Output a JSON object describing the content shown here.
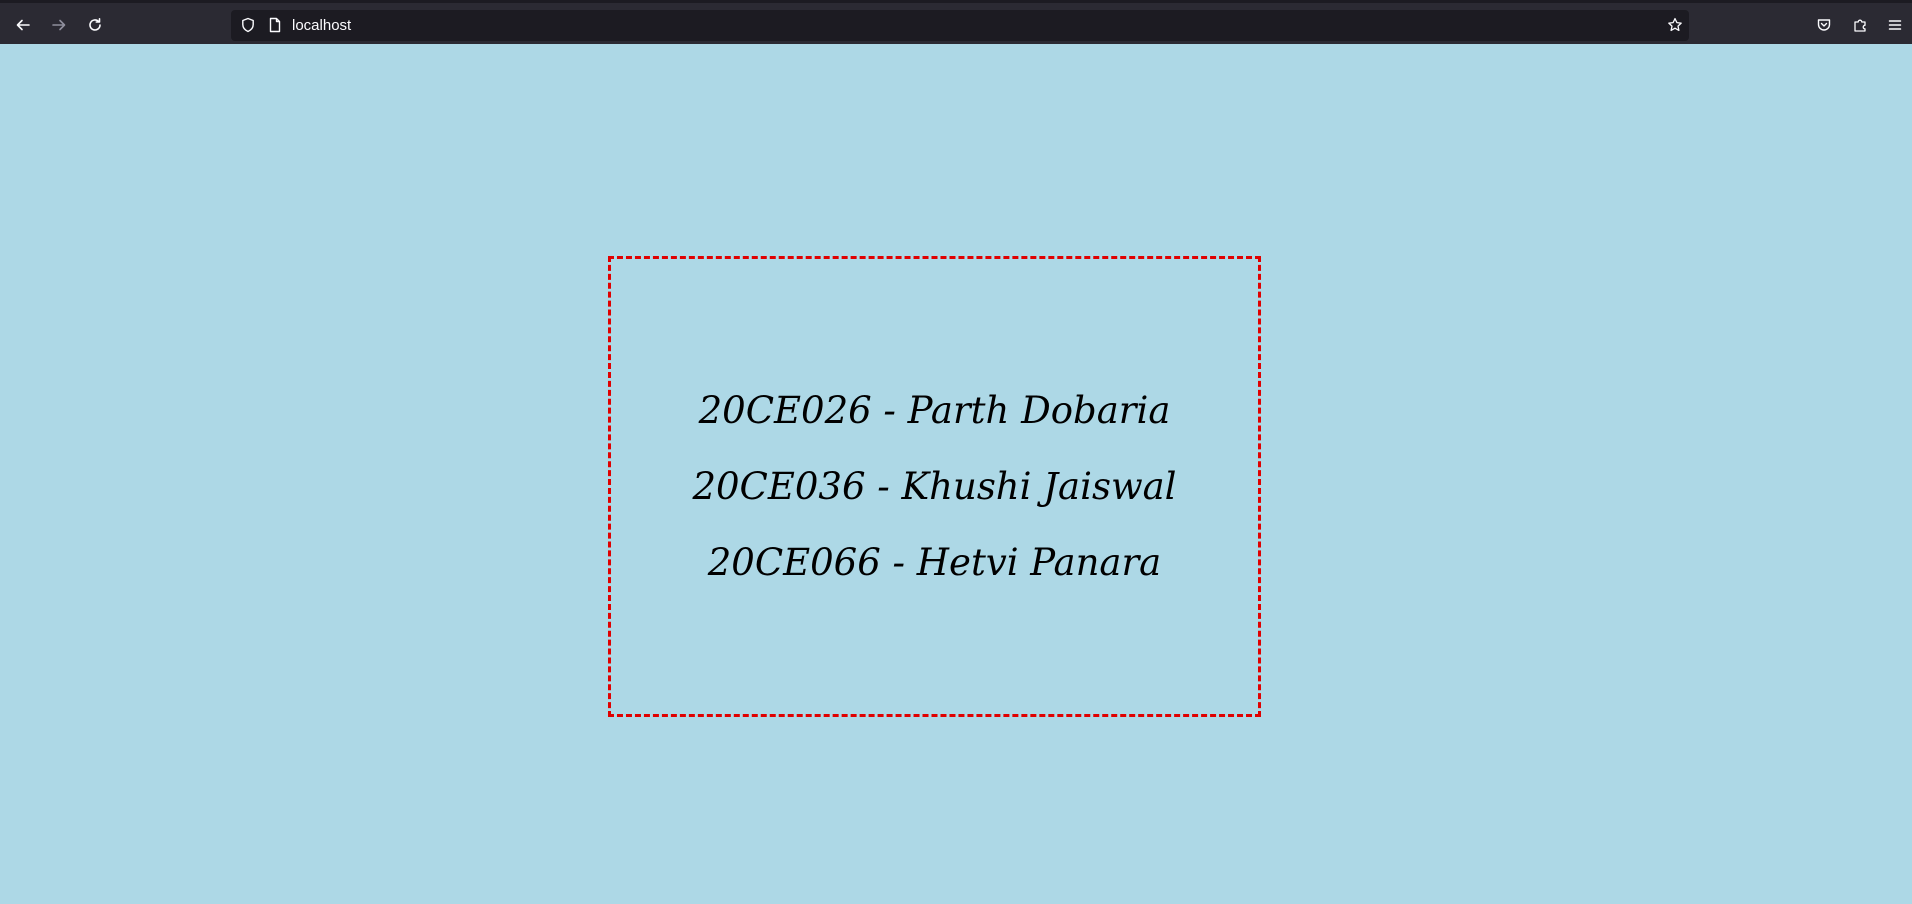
{
  "browser": {
    "url": "localhost",
    "icons": {
      "back": "back-arrow-icon",
      "forward": "forward-arrow-icon",
      "reload": "reload-icon",
      "tracking": "shield-icon",
      "page": "page-icon",
      "bookmark": "star-icon",
      "pocket": "pocket-icon",
      "extensions": "extensions-icon",
      "menu": "hamburger-menu-icon"
    }
  },
  "page": {
    "background": "#add8e6",
    "border_color": "#e00000",
    "members": [
      "20CE026 - Parth Dobaria",
      "20CE036 - Khushi Jaiswal",
      "20CE066 - Hetvi Panara"
    ]
  }
}
